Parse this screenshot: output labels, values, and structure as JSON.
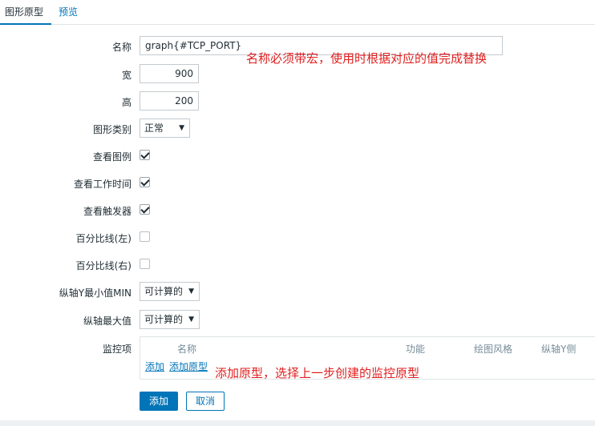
{
  "tabs": [
    {
      "label": "图形原型",
      "active": true
    },
    {
      "label": "预览",
      "active": false
    }
  ],
  "form": {
    "name": {
      "label": "名称",
      "value": "graph{#TCP_PORT}"
    },
    "width": {
      "label": "宽",
      "value": "900"
    },
    "height": {
      "label": "高",
      "value": "200"
    },
    "graph_type": {
      "label": "图形类别",
      "value": "正常"
    },
    "show_legend": {
      "label": "查看图例",
      "checked": true
    },
    "show_work_period": {
      "label": "查看工作时间",
      "checked": true
    },
    "show_triggers": {
      "label": "查看触发器",
      "checked": true
    },
    "percentile_left": {
      "label": "百分比线(左)",
      "checked": false
    },
    "percentile_right": {
      "label": "百分比线(右)",
      "checked": false
    },
    "y_min": {
      "label": "纵轴Y最小值MIN",
      "value": "可计算的"
    },
    "y_max": {
      "label": "纵轴最大值",
      "value": "可计算的"
    },
    "items": {
      "label": "监控项",
      "columns": [
        "名称",
        "功能",
        "绘图风格",
        "纵轴Y侧"
      ],
      "add_link": "添加",
      "add_prototype_link": "添加原型"
    }
  },
  "annotations": {
    "name_note": "名称必须带宏，使用时根据对应的值完成替换",
    "items_note": "添加原型，选择上一步创建的监控原型",
    "color": "#e02020"
  },
  "buttons": {
    "add": "添加",
    "cancel": "取消"
  },
  "colors": {
    "accent": "#0275b8",
    "text": "#1f2c33",
    "muted": "#768d99"
  },
  "icons": {
    "dropdown": "chevron-down-icon",
    "checkbox": "checkmark-icon"
  }
}
